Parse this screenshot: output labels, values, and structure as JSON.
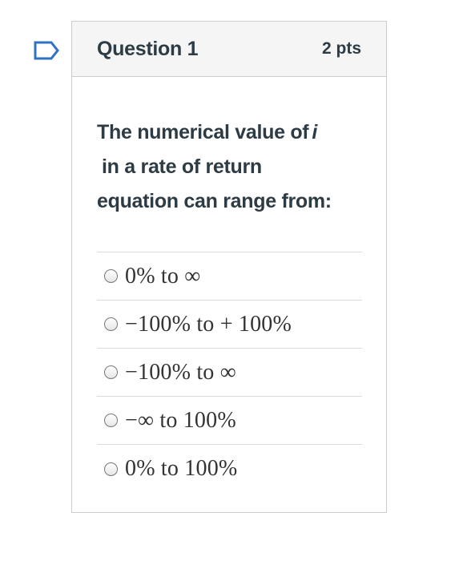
{
  "question": {
    "title": "Question 1",
    "points": "2 pts",
    "prompt_part1": "The numerical value of",
    "prompt_variable": "i",
    "prompt_part2": "in a rate of return",
    "prompt_part3": "equation can range from:"
  },
  "answers": [
    {
      "label": "0% to ∞"
    },
    {
      "label": "−100% to + 100%"
    },
    {
      "label": "−100% to ∞"
    },
    {
      "label": "−∞ to 100%"
    },
    {
      "label": "0% to 100%"
    }
  ],
  "icons": {
    "flag": "flag-question-icon",
    "radio": "radio-button-icon"
  },
  "colors": {
    "flag_stroke": "#2f72c4",
    "header_bg": "#f5f5f5",
    "text": "#2d3b45",
    "border": "#c7cdd1"
  }
}
